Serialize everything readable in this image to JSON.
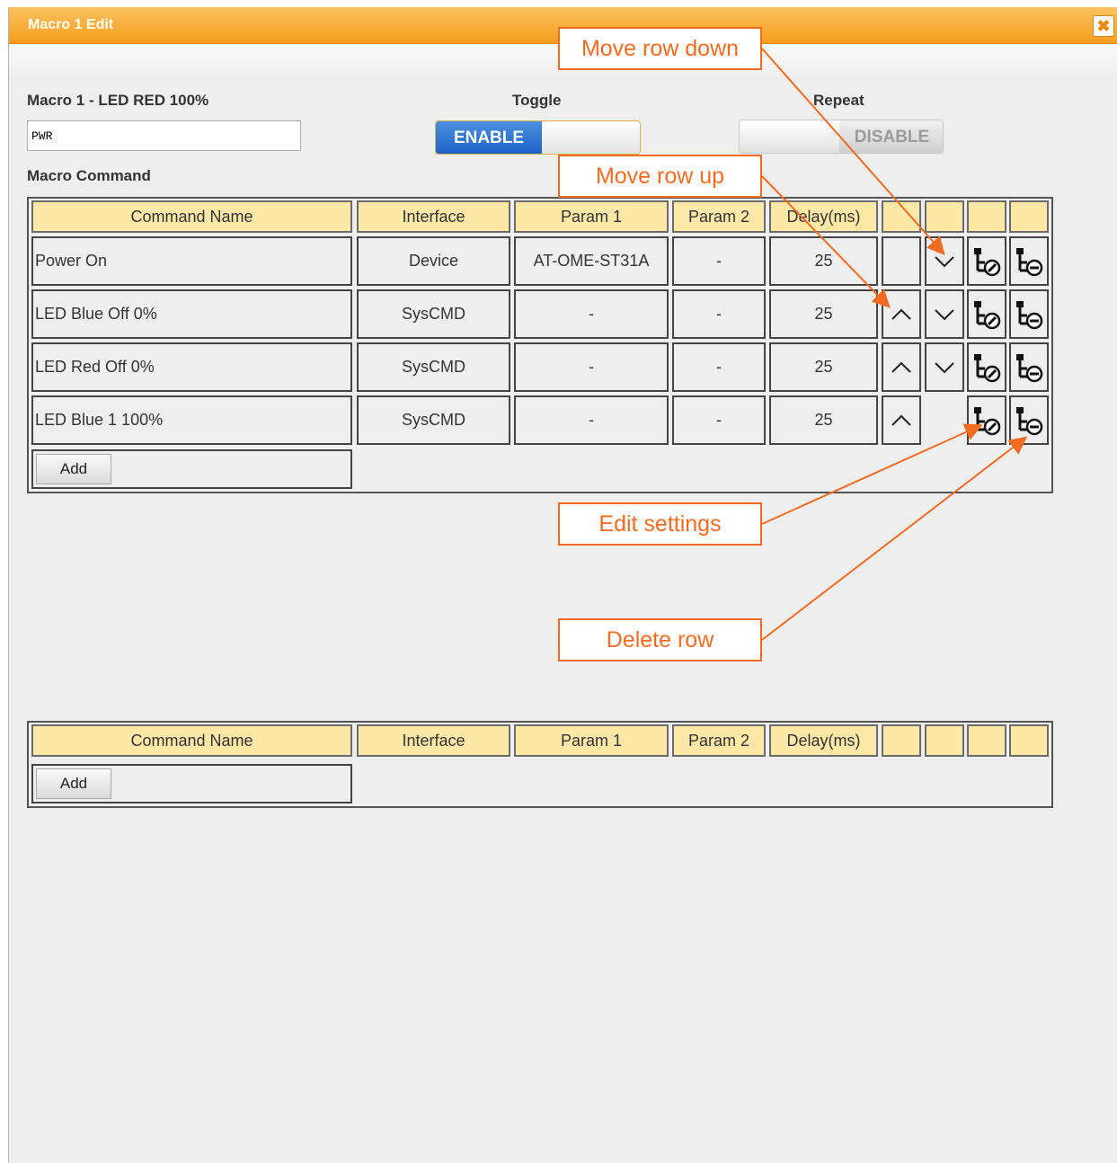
{
  "window": {
    "title": "Macro 1 Edit",
    "close_icon": "close-icon"
  },
  "form": {
    "macro_name_label": "Macro 1 - LED RED 100%",
    "macro_name_value": "PWR",
    "toggle_label": "Toggle",
    "toggle_on_text": "ENABLE",
    "repeat_label": "Repeat",
    "repeat_off_text": "DISABLE",
    "section_label": "Macro Command"
  },
  "table_headers": [
    "Command Name",
    "Interface",
    "Param 1",
    "Param 2",
    "Delay(ms)"
  ],
  "commands": [
    {
      "name": "Power On",
      "interface": "Device",
      "param1": "AT-OME-ST31A",
      "param2": "-",
      "delay": "25",
      "up": false,
      "down": true
    },
    {
      "name": "LED Blue Off 0%",
      "interface": "SysCMD",
      "param1": "-",
      "param2": "-",
      "delay": "25",
      "up": true,
      "down": true
    },
    {
      "name": "LED Red Off 0%",
      "interface": "SysCMD",
      "param1": "-",
      "param2": "-",
      "delay": "25",
      "up": true,
      "down": true
    },
    {
      "name": "LED Blue 1 100%",
      "interface": "SysCMD",
      "param1": "-",
      "param2": "-",
      "delay": "25",
      "up": true,
      "down": false
    }
  ],
  "add_label": "Add",
  "callouts": {
    "move_down": "Move row down",
    "move_up": "Move row up",
    "edit": "Edit settings",
    "delete": "Delete row"
  },
  "colors": {
    "titlebar": "#f7a52a",
    "header_cell": "#fde8a8",
    "callout": "#f26b22",
    "toggle_on": "#1e63c4"
  }
}
